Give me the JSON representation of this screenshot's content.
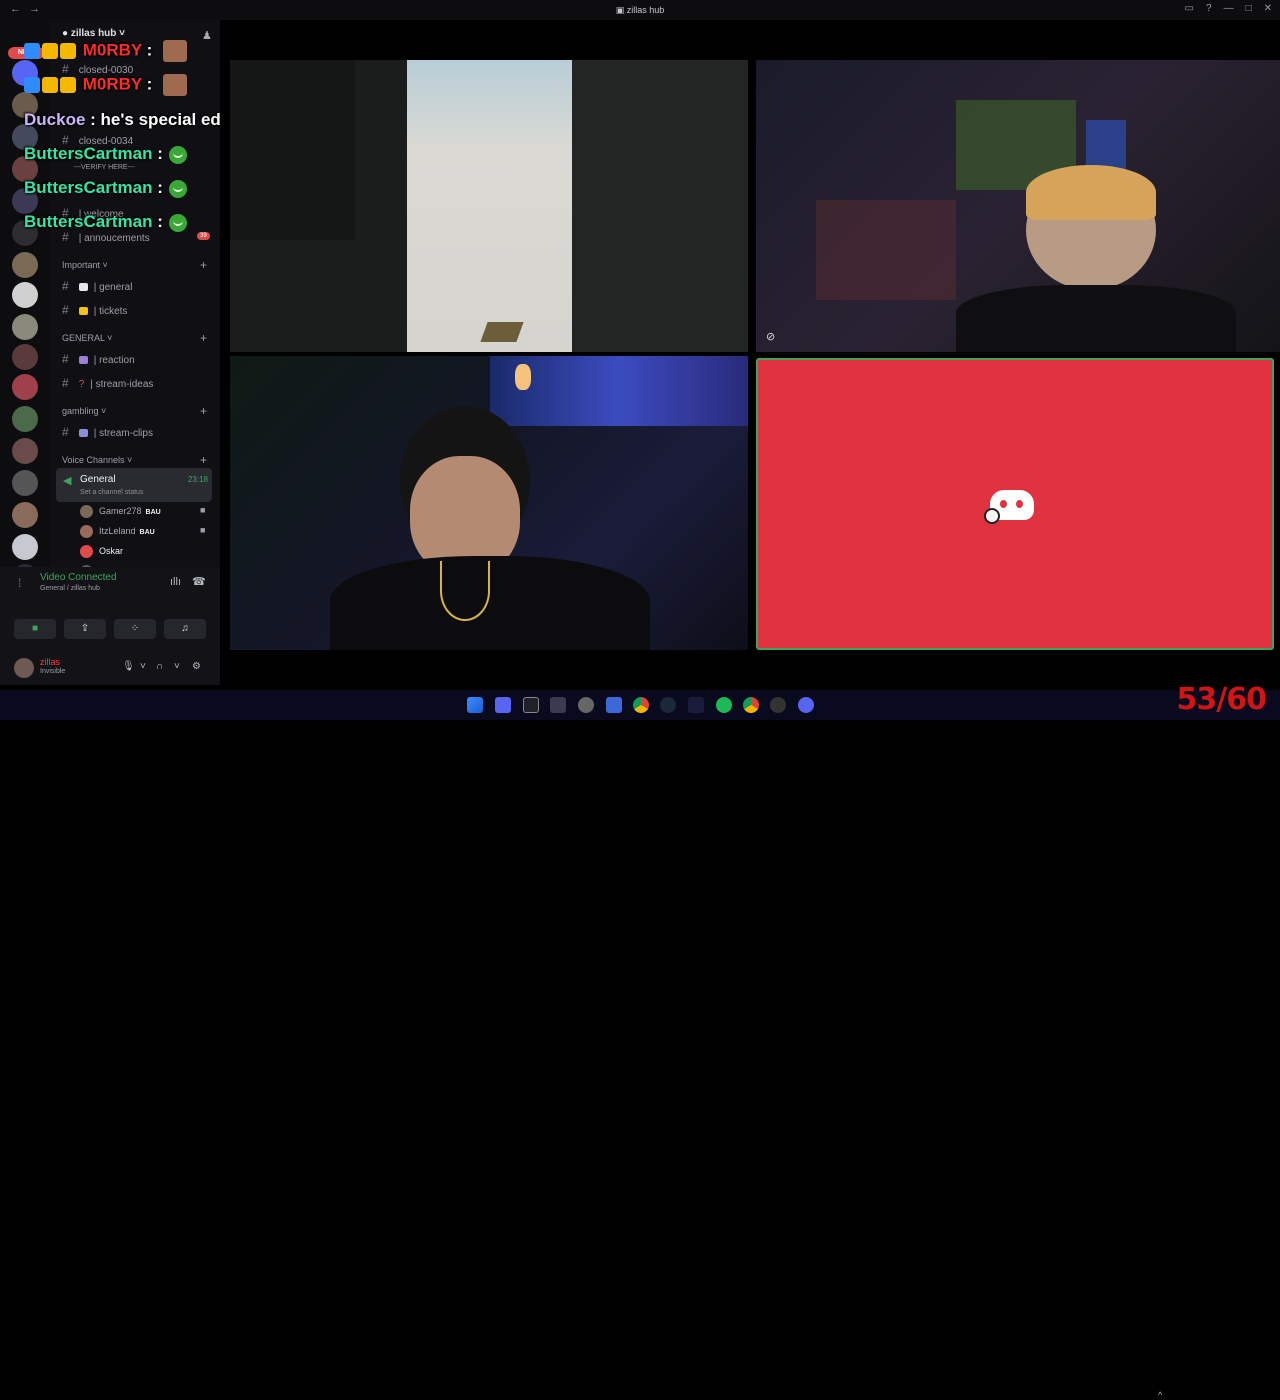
{
  "window": {
    "title": "zillas hub",
    "nav_back": "←",
    "nav_fwd": "→"
  },
  "servers": {
    "new_badge": "NEW"
  },
  "sidebar": {
    "server_name": "zillas hub ˅",
    "channels_top": [
      {
        "label": "closed-0030"
      },
      {
        "label": "closed-0034"
      },
      {
        "label": "---VERIFY HERE---"
      },
      {
        "label": "| welcome"
      },
      {
        "label": "| annoucements",
        "badge": "39"
      }
    ],
    "categories": {
      "important": "Important ˅",
      "general": "GENERAL ˅",
      "gambling": "gambling ˅",
      "voice": "Voice Channels ˅"
    },
    "channels": {
      "general": "| general",
      "tickets": "| tickets",
      "reaction": "| reaction",
      "stream_ideas": "| stream-ideas",
      "stream_clips": "| stream-clips"
    },
    "voice_general": {
      "label": "General",
      "status": "Set a channel status",
      "time": "23:18"
    },
    "voice_users": [
      {
        "name": "Gamer278",
        "tag": "BAU"
      },
      {
        "name": "ItzLeland",
        "tag": "BAU"
      },
      {
        "name": "Oskar",
        "tag": ""
      },
      {
        "name": "zillas",
        "tag": ""
      }
    ]
  },
  "voice_panel": {
    "title": "Video Connected",
    "subtitle": "General / zillas hub"
  },
  "user_panel": {
    "name": "zillas",
    "status": "Invisible"
  },
  "chat_overlay": [
    {
      "user": "M0RBY",
      "text": ":",
      "color": "#ff2a2a"
    },
    {
      "user": "M0RBY",
      "text": ":",
      "color": "#ff2a2a"
    },
    {
      "user": "Duckoe",
      "text": ": he's special ed",
      "color": "#c9b6ff"
    },
    {
      "user": "ButtersCartman",
      "text": ":",
      "color": "#33e6a6"
    },
    {
      "user": "ButtersCartman",
      "text": ":",
      "color": "#33e6a6"
    },
    {
      "user": "ButtersCartman",
      "text": ":",
      "color": "#33e6a6"
    }
  ],
  "overlay": {
    "fps": "53/60"
  },
  "colors": {
    "accent_green": "#3ba55d",
    "discord_red": "#e0333f",
    "muted_red": "#ff3b3b"
  }
}
